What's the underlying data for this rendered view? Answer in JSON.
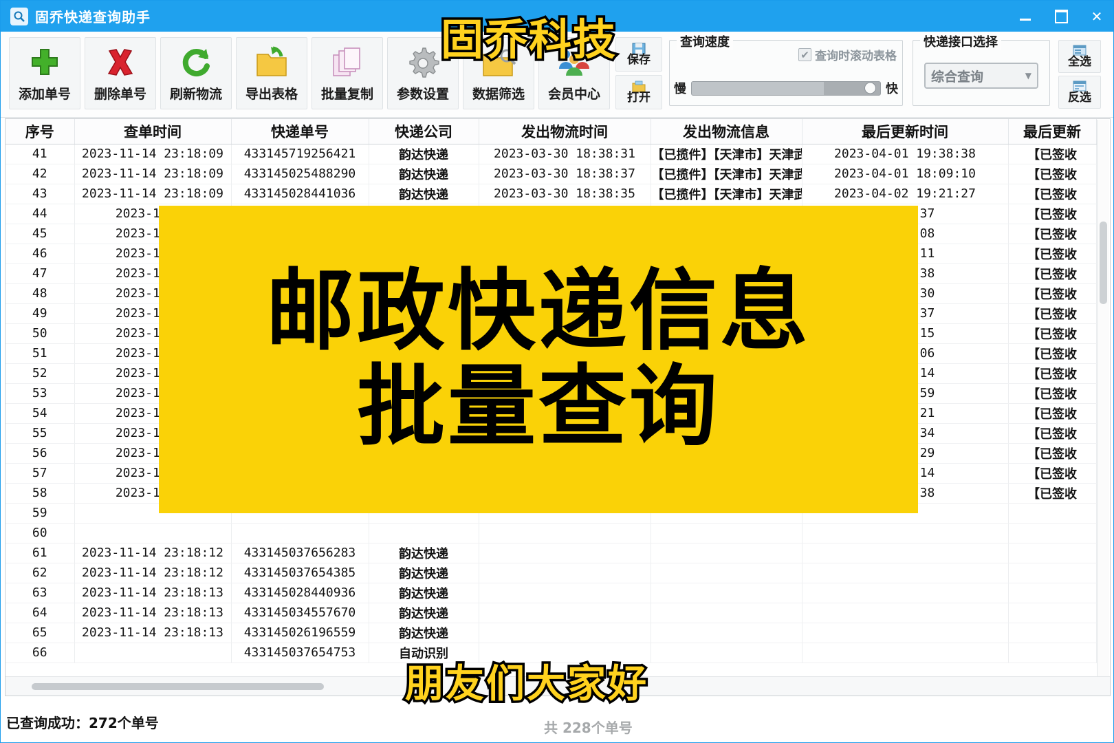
{
  "window": {
    "title": "固乔快递查询助手",
    "icon": "magnifier-icon",
    "accent_color": "#1fa1ee",
    "minimize_label": "",
    "maximize_label": "",
    "close_label": "✕"
  },
  "toolbar": {
    "buttons": [
      {
        "label": "添加单号",
        "icon": "plus-green-icon"
      },
      {
        "label": "删除单号",
        "icon": "cross-red-icon"
      },
      {
        "label": "刷新物流",
        "icon": "refresh-green-icon"
      },
      {
        "label": "导出表格",
        "icon": "folder-export-icon"
      },
      {
        "label": "批量复制",
        "icon": "copy-pages-icon"
      },
      {
        "label": "参数设置",
        "icon": "gear-icon"
      },
      {
        "label": "数据筛选",
        "icon": "folder-filter-icon"
      },
      {
        "label": "会员中心",
        "icon": "members-icon"
      }
    ],
    "file_buttons": [
      {
        "label": "保存",
        "icon": "save-icon"
      },
      {
        "label": "打开",
        "icon": "open-folder-icon"
      }
    ]
  },
  "speed_group": {
    "title": "查询速度",
    "checkbox_label": "查询时滚动表格",
    "checkbox_checked": true,
    "slow_label": "慢",
    "fast_label": "快",
    "value_percent": 93
  },
  "interface_group": {
    "title": "快递接口选择",
    "selected": "综合查询",
    "arrow_icon": "chevron-down-icon"
  },
  "select_buttons": [
    {
      "label": "全选",
      "icon": "select-all-icon"
    },
    {
      "label": "反选",
      "icon": "invert-select-icon"
    }
  ],
  "table": {
    "columns": [
      "序号",
      "查单时间",
      "快递单号",
      "快递公司",
      "发出物流时间",
      "发出物流信息",
      "最后更新时间",
      "最后更新"
    ],
    "rows": [
      [
        "41",
        "2023-11-14 23:18:09",
        "433145719256421",
        "韵达快递",
        "2023-03-30 18:38:31",
        "【已揽件】【天津市】天津武清…",
        "2023-04-01 19:38:38",
        "【已签收"
      ],
      [
        "42",
        "2023-11-14 23:18:09",
        "433145025488290",
        "韵达快递",
        "2023-03-30 18:38:37",
        "【已揽件】【天津市】天津武清…",
        "2023-04-01 18:09:10",
        "【已签收"
      ],
      [
        "43",
        "2023-11-14 23:18:09",
        "433145028441036",
        "韵达快递",
        "2023-03-30 18:38:35",
        "【已揽件】【天津市】天津武清…",
        "2023-04-02 19:21:27",
        "【已签收"
      ],
      [
        "44",
        "2023-11-14",
        "",
        "",
        "",
        "",
        "19:56:37",
        "【已签收"
      ],
      [
        "45",
        "2023-11-14",
        "",
        "",
        "",
        "",
        "17:33:08",
        "【已签收"
      ],
      [
        "46",
        "2023-11-14",
        "",
        "",
        "",
        "",
        "17:49:11",
        "【已签收"
      ],
      [
        "47",
        "2023-11-14",
        "",
        "",
        "",
        "",
        "14:47:38",
        "【已签收"
      ],
      [
        "48",
        "2023-11-14",
        "",
        "",
        "",
        "",
        "16:34:30",
        "【已签收"
      ],
      [
        "49",
        "2023-11-14",
        "",
        "",
        "",
        "",
        "20:19:37",
        "【已签收"
      ],
      [
        "50",
        "2023-11-14",
        "",
        "",
        "",
        "",
        "10:59:15",
        "【已签收"
      ],
      [
        "51",
        "2023-11-14",
        "",
        "",
        "",
        "",
        "18:58:06",
        "【已签收"
      ],
      [
        "52",
        "2023-11-14",
        "",
        "",
        "",
        "",
        "17:53:14",
        "【已签收"
      ],
      [
        "53",
        "2023-11-14",
        "",
        "",
        "",
        "",
        "11:20:59",
        "【已签收"
      ],
      [
        "54",
        "2023-11-14",
        "",
        "",
        "",
        "",
        "20:03:21",
        "【已签收"
      ],
      [
        "55",
        "2023-11-14",
        "",
        "",
        "",
        "",
        "15:22:34",
        "【已签收"
      ],
      [
        "56",
        "2023-11-14",
        "",
        "",
        "",
        "",
        "16:45:29",
        "【已签收"
      ],
      [
        "57",
        "2023-11-14",
        "",
        "",
        "",
        "",
        "10:35:14",
        "【已签收"
      ],
      [
        "58",
        "2023-11-14",
        "",
        "",
        "",
        "",
        "18:53:38",
        "【已签收"
      ],
      [
        "59",
        "",
        "",
        "",
        "",
        "",
        "",
        ""
      ],
      [
        "60",
        "",
        "",
        "",
        "",
        "",
        "",
        ""
      ],
      [
        "61",
        "2023-11-14 23:18:12",
        "433145037656283",
        "韵达快递",
        "",
        "",
        "",
        ""
      ],
      [
        "62",
        "2023-11-14 23:18:12",
        "433145037654385",
        "韵达快递",
        "",
        "",
        "",
        ""
      ],
      [
        "63",
        "2023-11-14 23:18:13",
        "433145028440936",
        "韵达快递",
        "",
        "",
        "",
        ""
      ],
      [
        "64",
        "2023-11-14 23:18:13",
        "433145034557670",
        "韵达快递",
        "",
        "",
        "",
        ""
      ],
      [
        "65",
        "2023-11-14 23:18:13",
        "433145026196559",
        "韵达快递",
        "",
        "",
        "",
        ""
      ],
      [
        "66",
        "",
        "433145037654753",
        "自动识别",
        "",
        "",
        "",
        ""
      ]
    ]
  },
  "statusbar": {
    "left_text": "已查询成功：272个单号",
    "center_text": "共 228个单号"
  },
  "overlay": {
    "brand": "固乔科技",
    "banner_line1": "邮政快递信息",
    "banner_line2": "批量查询",
    "banner_color": "#fad207",
    "subtitle": "朋友们大家好",
    "caption_color": "#ffd21e"
  }
}
